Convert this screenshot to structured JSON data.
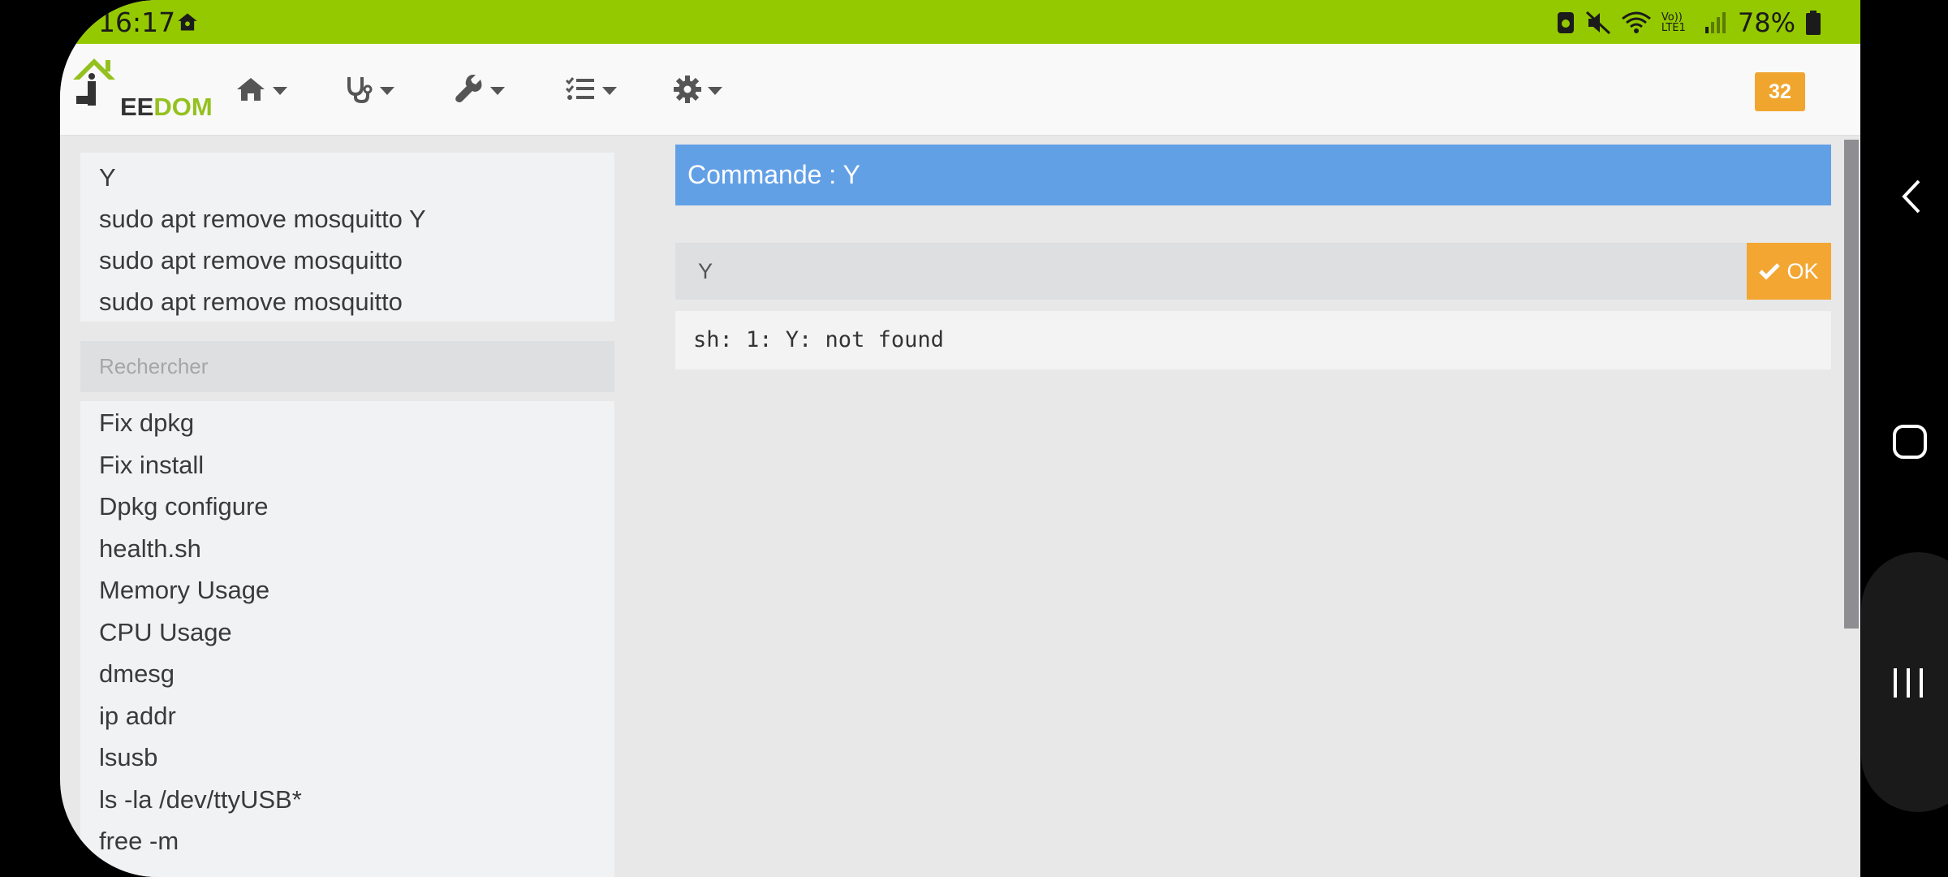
{
  "status_bar": {
    "time": "16:17",
    "battery_percent": "78%",
    "icons": [
      "home-status-icon",
      "sim-icon",
      "mute-icon",
      "wifi-icon",
      "volte-icon",
      "signal-icon",
      "battery-icon"
    ],
    "volte_label": "Vo)) LTE1"
  },
  "navbar": {
    "logo_text_dark": "EE",
    "logo_text_green": "DOM",
    "logo_letter": "J",
    "menus": [
      {
        "icon": "home-icon"
      },
      {
        "icon": "stethoscope-icon"
      },
      {
        "icon": "wrench-icon"
      },
      {
        "icon": "tasks-icon"
      },
      {
        "icon": "gear-icon"
      }
    ],
    "notification_count": "32"
  },
  "history": {
    "items": [
      "Y",
      "sudo apt remove mosquitto Y",
      "sudo apt remove mosquitto",
      "sudo apt remove mosquitto"
    ]
  },
  "search": {
    "placeholder": "Rechercher"
  },
  "commands": {
    "items": [
      "Fix dpkg",
      "Fix install",
      "Dpkg configure",
      "health.sh",
      "Memory Usage",
      "CPU Usage",
      "dmesg",
      "ip addr",
      "lsusb",
      "ls -la /dev/ttyUSB*",
      "free -m"
    ]
  },
  "console": {
    "header": "Commande : Y",
    "input_value": "Y",
    "ok_label": "OK",
    "output": "sh: 1: Y: not found"
  },
  "colors": {
    "status_bar": "#94c900",
    "header_blue": "#62a0e6",
    "ok_orange": "#f3a632",
    "badge_orange": "#f0a62e"
  }
}
